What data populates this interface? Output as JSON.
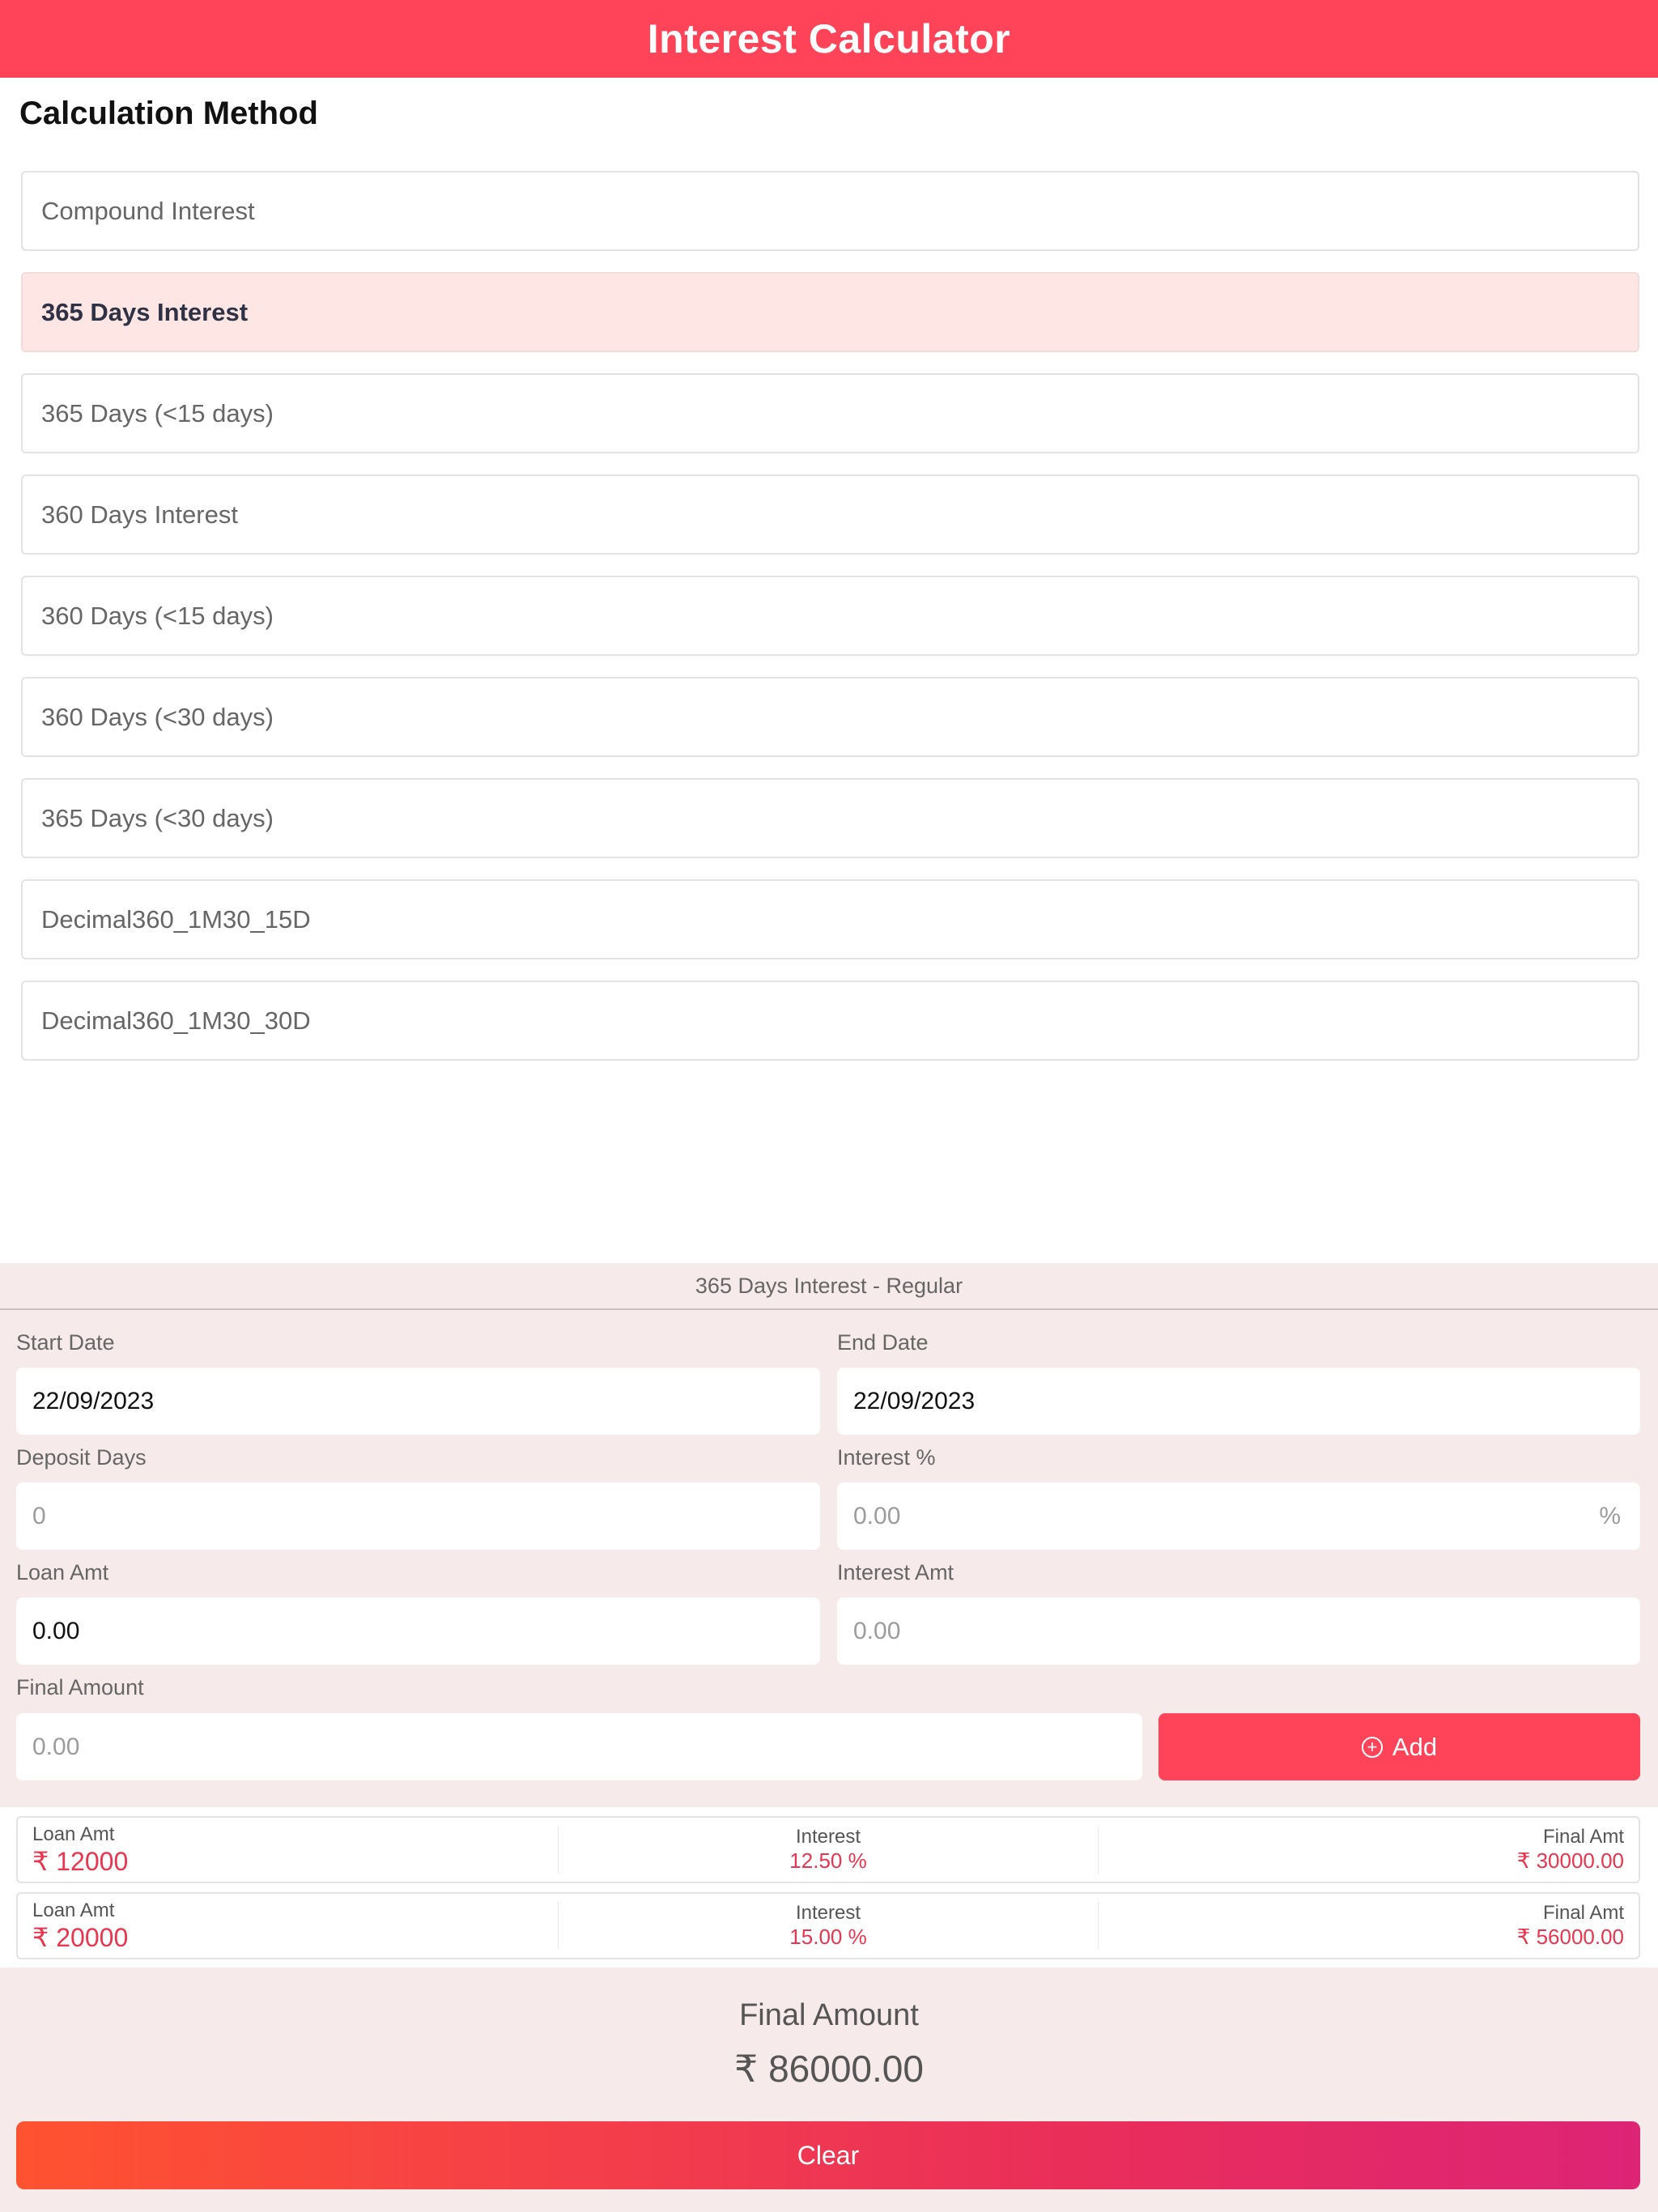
{
  "header": {
    "title": "Interest Calculator"
  },
  "calculation_method": {
    "title": "Calculation Method",
    "items": [
      {
        "label": "Compound Interest",
        "selected": false
      },
      {
        "label": "365 Days Interest",
        "selected": true
      },
      {
        "label": "365 Days (<15 days)",
        "selected": false
      },
      {
        "label": "360 Days Interest",
        "selected": false
      },
      {
        "label": "360 Days (<15 days)",
        "selected": false
      },
      {
        "label": "360 Days (<30 days)",
        "selected": false
      },
      {
        "label": "365 Days (<30 days)",
        "selected": false
      },
      {
        "label": "Decimal360_1M30_15D",
        "selected": false
      },
      {
        "label": "Decimal360_1M30_30D",
        "selected": false
      }
    ]
  },
  "calculator": {
    "panel_title": "365 Days Interest - Regular",
    "start_date": {
      "label": "Start Date",
      "value": "22/09/2023"
    },
    "end_date": {
      "label": "End Date",
      "value": "22/09/2023"
    },
    "deposit_days": {
      "label": "Deposit Days",
      "placeholder": "0"
    },
    "interest_pct": {
      "label": "Interest %",
      "placeholder": "0.00",
      "suffix": "%"
    },
    "loan_amt": {
      "label": "Loan Amt",
      "value": "0.00"
    },
    "interest_amt": {
      "label": "Interest Amt",
      "placeholder": "0.00"
    },
    "final_amount": {
      "label": "Final Amount",
      "placeholder": "0.00"
    },
    "add_button": {
      "label": "Add",
      "icon": "plus-circle-icon"
    }
  },
  "entries": [
    {
      "loan_label": "Loan Amt",
      "loan_value": "₹ 12000",
      "interest_label": "Interest",
      "interest_value": "12.50 %",
      "final_label": "Final Amt",
      "final_value": "₹ 30000.00"
    },
    {
      "loan_label": "Loan Amt",
      "loan_value": "₹ 20000",
      "interest_label": "Interest",
      "interest_value": "15.00 %",
      "final_label": "Final Amt",
      "final_value": "₹ 56000.00"
    }
  ],
  "summary": {
    "label": "Final Amount",
    "value": "₹ 86000.00",
    "clear_button": "Clear"
  },
  "colors": {
    "brand": "#ff4358",
    "selected_bg": "#fde6e4",
    "panel_bg": "#f6eaea",
    "value_red": "#ea3550",
    "gradient_start": "#ff5230",
    "gradient_end": "#dd2475"
  }
}
